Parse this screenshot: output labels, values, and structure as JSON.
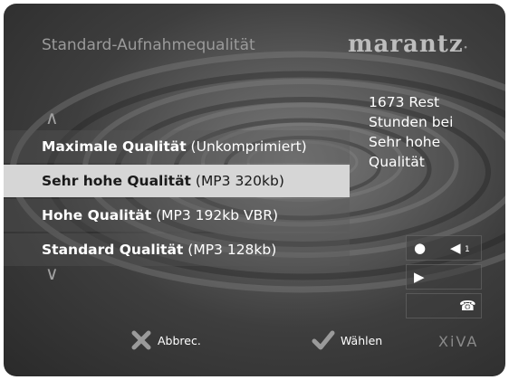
{
  "header": {
    "title": "Standard-Aufnahmequalität",
    "brand": "marantz"
  },
  "nav": {
    "up_icon": "chevron-up-icon",
    "down_icon": "chevron-down-icon"
  },
  "quality_list": {
    "items": [
      {
        "name": "Maximale Qualität",
        "detail": "(Unkomprimiert)",
        "selected": false
      },
      {
        "name": "Sehr hohe Qualität",
        "detail": "(MP3 320kb)",
        "selected": true
      },
      {
        "name": "Hohe Qualität",
        "detail": "(MP3 192kb VBR)",
        "selected": false
      },
      {
        "name": "Standard Qualität",
        "detail": "(MP3 128kb)",
        "selected": false
      }
    ]
  },
  "info": {
    "line1": "1673 Rest",
    "line2": "Stunden bei",
    "line3": "Sehr hohe",
    "line4": "Qualität"
  },
  "status_panel": {
    "record_icon": "record-icon",
    "volume_icon": "volume-icon",
    "volume_level": "1",
    "play_icon": "play-icon",
    "phone_icon": "phone-icon"
  },
  "footer": {
    "cancel_label": "Abbrec.",
    "select_label": "Wählen",
    "brand": "XiVA"
  },
  "colors": {
    "selected_bg": "#d6d6d6",
    "text": "#ffffff"
  }
}
